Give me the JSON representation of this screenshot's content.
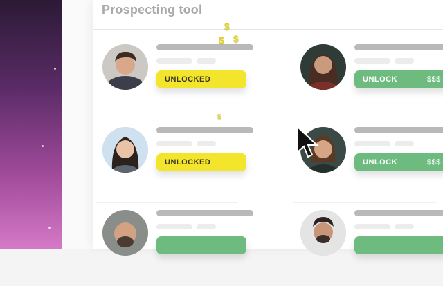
{
  "app": {
    "title": "Prospecting tool"
  },
  "buttons": {
    "unlocked_label": "UNLOCKED",
    "unlock_label": "UNLOCK",
    "price_label": "$$$"
  },
  "decorations": {
    "coin_symbol": "$"
  },
  "colors": {
    "unlocked_yellow": "#f3e52b",
    "unlock_green": "#6dbb7f",
    "desktop_purple": "#a04a9a"
  }
}
